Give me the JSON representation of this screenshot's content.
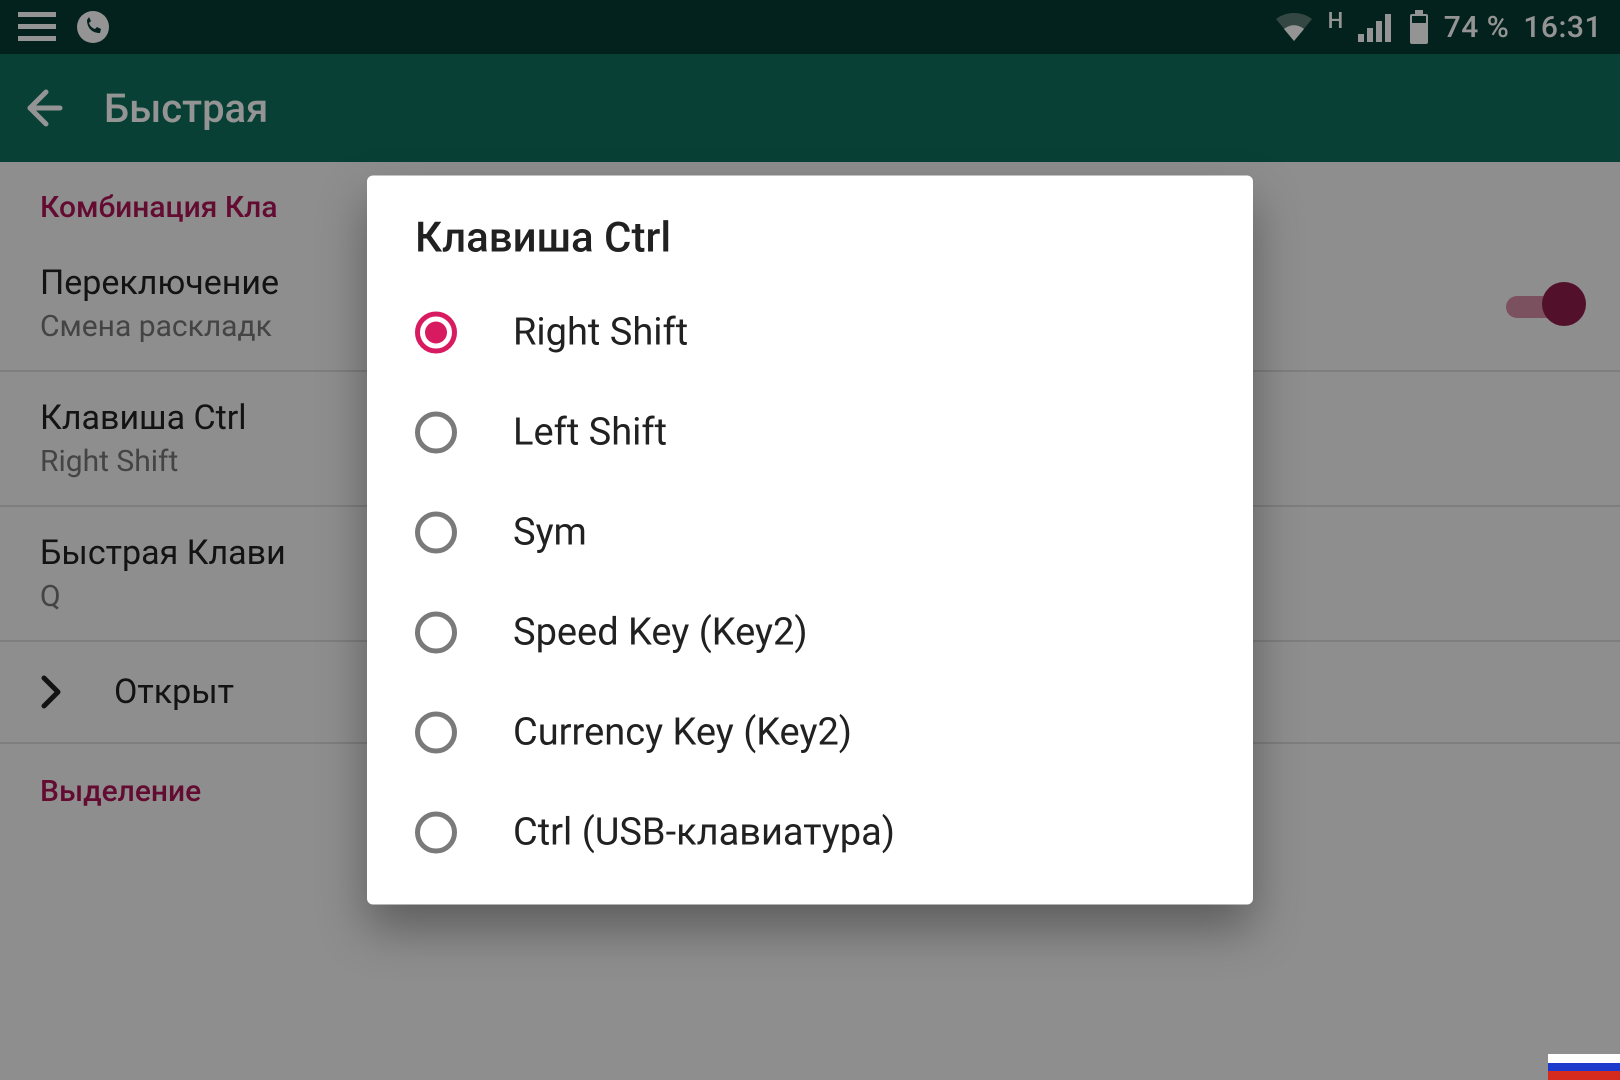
{
  "statusbar": {
    "battery_text": "74 %",
    "time": "16:31",
    "network_letter": "H"
  },
  "appbar": {
    "title": "Быстрая"
  },
  "sections": {
    "combo_header": "Комбинация Кла",
    "switch_title": "Переключение",
    "switch_sub": "Смена раскладк",
    "ctrl_title": "Клавиша Ctrl",
    "ctrl_sub": "Right Shift",
    "fast_title": "Быстрая Клави",
    "fast_sub": "Q",
    "open_title": "Открыт",
    "highlight_header": "Выделение"
  },
  "dialog": {
    "title": "Клавиша Ctrl",
    "options": [
      "Right Shift",
      "Left Shift",
      "Sym",
      "Speed Key (Key2)",
      "Currency Key (Key2)",
      "Ctrl (USB-клавиатура)"
    ],
    "selected_index": 0
  },
  "colors": {
    "accent": "#d81b60",
    "appbar": "#0e6f5e",
    "statusbar": "#063c32"
  }
}
